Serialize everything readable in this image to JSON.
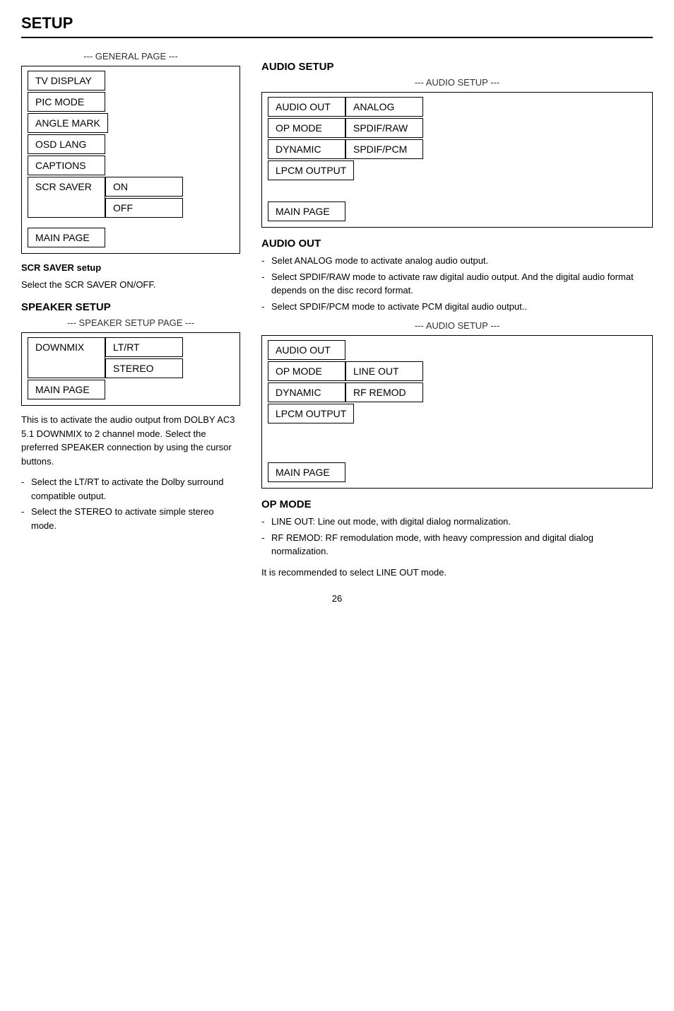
{
  "page": {
    "title": "SETUP",
    "page_number": "26"
  },
  "left_column": {
    "general_section": {
      "label": "--- GENERAL PAGE ---",
      "menu_items": [
        {
          "label": "TV DISPLAY"
        },
        {
          "label": "PIC MODE"
        },
        {
          "label": "ANGLE MARK"
        },
        {
          "label": "OSD LANG"
        },
        {
          "label": "CAPTIONS"
        },
        {
          "label": "SCR SAVER"
        }
      ],
      "scr_saver_options": [
        "ON",
        "OFF"
      ],
      "main_page_label": "MAIN PAGE"
    },
    "scr_saver_desc": {
      "title": "SCR SAVER setup",
      "body": "Select the SCR SAVER ON/OFF."
    },
    "speaker_section": {
      "title": "SPEAKER SETUP",
      "label": "--- SPEAKER SETUP PAGE ---",
      "menu_items": [
        {
          "label": "DOWNMIX"
        }
      ],
      "downmix_options": [
        "LT/RT",
        "STEREO"
      ],
      "main_page_label": "MAIN PAGE",
      "description": "This is to activate the audio output from DOLBY AC3 5.1 DOWNMIX to 2 channel mode.  Select the preferred SPEAKER connection by using the cursor buttons.",
      "bullets": [
        "Select the LT/RT to activate the Dolby surround compatible output.",
        "Select the STEREO to activate simple stereo mode."
      ]
    }
  },
  "right_column": {
    "audio_setup_title": "AUDIO SETUP",
    "audio_setup_first": {
      "label": "--- AUDIO SETUP ---",
      "rows": [
        {
          "left": "AUDIO OUT",
          "right": "ANALOG"
        },
        {
          "left": "OP MODE",
          "right": "SPDIF/RAW"
        },
        {
          "left": "DYNAMIC",
          "right": "SPDIF/PCM"
        },
        {
          "left": "LPCM OUTPUT",
          "right": ""
        }
      ],
      "main_page_label": "MAIN PAGE"
    },
    "audio_out_section": {
      "title": "AUDIO OUT",
      "bullets": [
        "Selet ANALOG mode to activate analog audio output.",
        "Select SPDIF/RAW mode to activate raw digital audio output. And the digital audio format depends on the disc record format.",
        "Select SPDIF/PCM mode to activate PCM digital audio output.."
      ]
    },
    "audio_setup_second": {
      "label": "--- AUDIO SETUP ---",
      "rows": [
        {
          "left": "AUDIO OUT",
          "right": ""
        },
        {
          "left": "OP MODE",
          "right": "LINE OUT"
        },
        {
          "left": "DYNAMIC",
          "right": "RF REMOD"
        },
        {
          "left": "LPCM OUTPUT",
          "right": ""
        }
      ],
      "main_page_label": "MAIN PAGE"
    },
    "op_mode_section": {
      "title": "OP MODE",
      "bullets": [
        "LINE OUT: Line out mode, with digital dialog normalization.",
        "RF REMOD: RF remodulation mode, with heavy compression and digital dialog normalization."
      ],
      "note": "It is recommended to select LINE OUT mode."
    }
  }
}
